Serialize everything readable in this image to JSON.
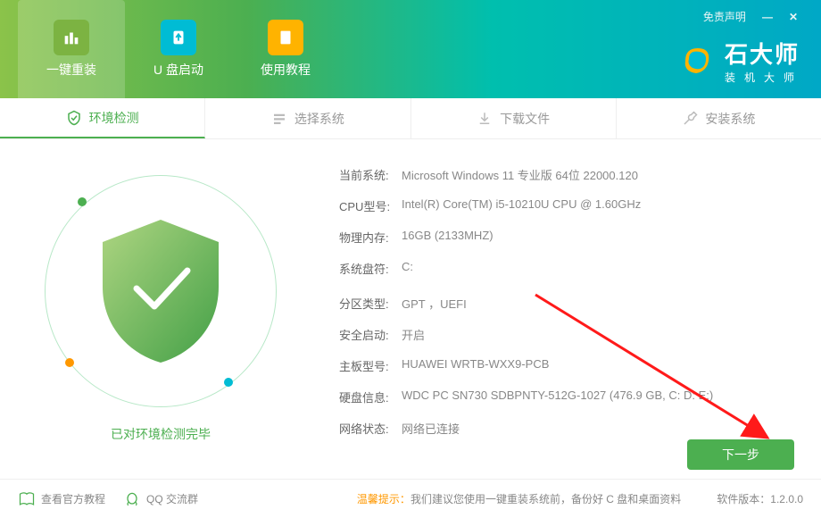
{
  "window": {
    "disclaimer": "免责声明",
    "minimize": "—",
    "close": "✕"
  },
  "brand": {
    "title": "石大师",
    "subtitle": "装机大师"
  },
  "header_tabs": [
    {
      "label": "一键重装"
    },
    {
      "label": "U 盘启动"
    },
    {
      "label": "使用教程"
    }
  ],
  "steps": [
    {
      "label": "环境检测"
    },
    {
      "label": "选择系统"
    },
    {
      "label": "下载文件"
    },
    {
      "label": "安装系统"
    }
  ],
  "shield": {
    "status": "已对环境检测完毕"
  },
  "info": {
    "rows": [
      {
        "label": "当前系统:",
        "value": "Microsoft Windows 11 专业版 64位 22000.120"
      },
      {
        "label": "CPU型号:",
        "value": "Intel(R) Core(TM) i5-10210U CPU @ 1.60GHz"
      },
      {
        "label": "物理内存:",
        "value": "16GB (2133MHZ)"
      },
      {
        "label": "系统盘符:",
        "value": "C:"
      },
      {
        "label": "分区类型:",
        "value": "GPT ，UEFI"
      },
      {
        "label": "安全启动:",
        "value": "开启"
      },
      {
        "label": "主板型号:",
        "value": "HUAWEI WRTB-WXX9-PCB"
      },
      {
        "label": "硬盘信息:",
        "value": "WDC PC SN730 SDBPNTY-512G-1027   (476.9 GB, C: D: E:)"
      },
      {
        "label": "网络状态:",
        "value": "网络已连接"
      }
    ]
  },
  "actions": {
    "next": "下一步"
  },
  "footer": {
    "tutorial": "查看官方教程",
    "qq": "QQ 交流群",
    "tip_label": "温馨提示：",
    "tip_text": "我们建议您使用一键重装系统前，备份好 C 盘和桌面资料",
    "version_label": "软件版本：",
    "version": "1.2.0.0"
  }
}
